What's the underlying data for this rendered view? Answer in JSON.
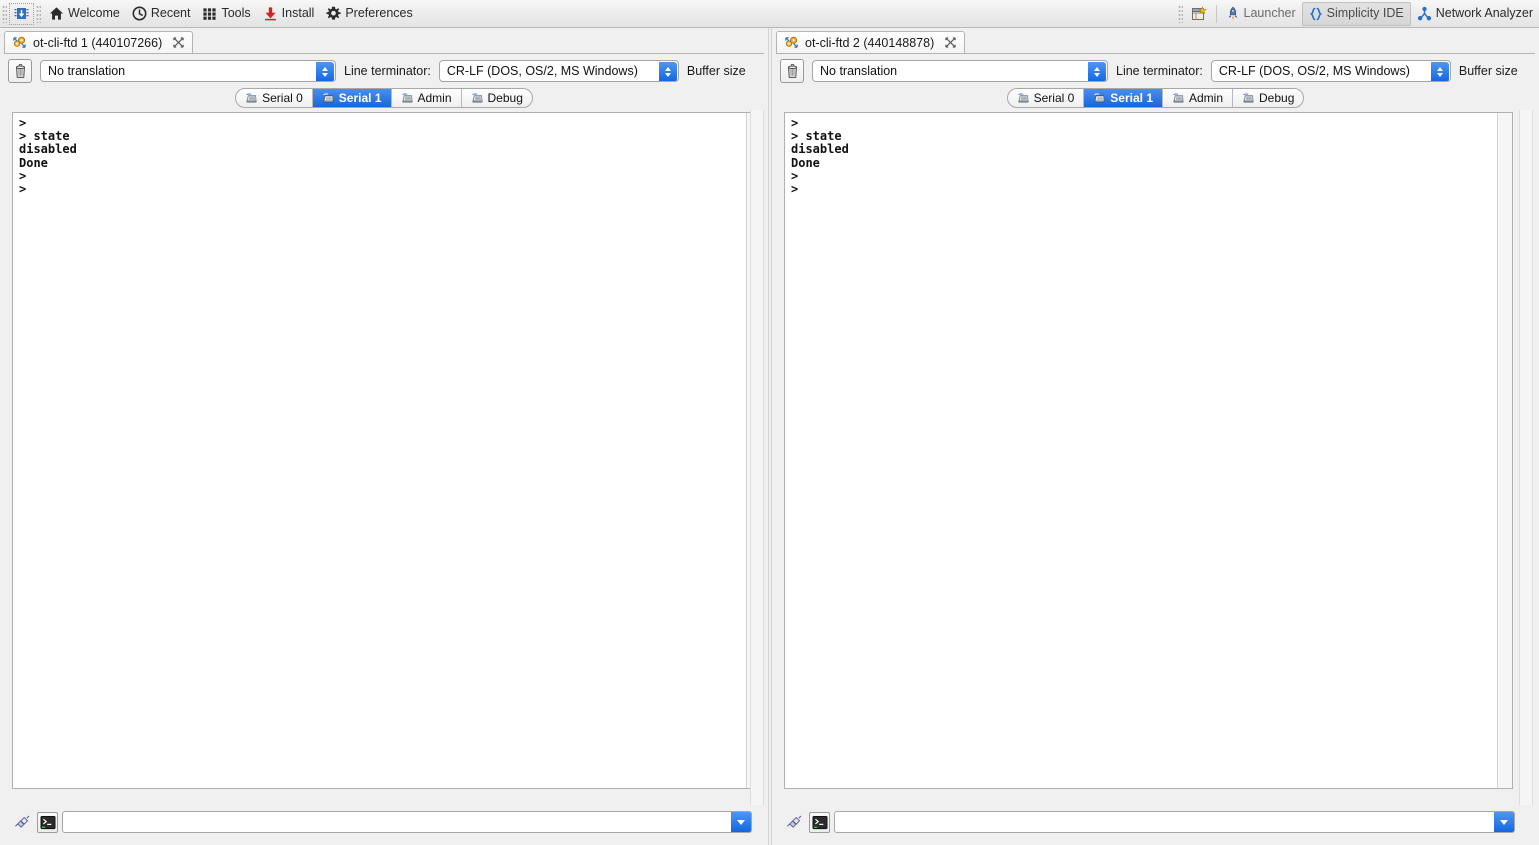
{
  "toolbar": {
    "left_items": [
      {
        "id": "chip",
        "label": "",
        "icon": "chip-icon"
      },
      {
        "id": "welcome",
        "label": "Welcome",
        "icon": "home-icon"
      },
      {
        "id": "recent",
        "label": "Recent",
        "icon": "clock-icon"
      },
      {
        "id": "tools",
        "label": "Tools",
        "icon": "grid-icon"
      },
      {
        "id": "install",
        "label": "Install",
        "icon": "download-icon"
      },
      {
        "id": "preferences",
        "label": "Preferences",
        "icon": "gear-icon"
      }
    ],
    "right_items": [
      {
        "id": "open-perspective",
        "label": "",
        "icon": "open-perspective-icon"
      },
      {
        "id": "launcher",
        "label": "Launcher",
        "icon": "rocket-icon"
      },
      {
        "id": "simplicity-ide",
        "label": "Simplicity IDE",
        "icon": "braces-icon"
      },
      {
        "id": "network-analyzer",
        "label": "Network Analyzer",
        "icon": "network-icon"
      }
    ],
    "active_perspective": "Simplicity IDE",
    "window_controls": {
      "minimize": "minimize-icon",
      "maximize": "maximize-icon"
    }
  },
  "colors": {
    "accent_blue": "#1565d8",
    "tab_gradient_top": "#4d90ee",
    "tab_gradient_bottom": "#1565d8",
    "toolbar_bg": "#ececec",
    "console_bg": "#ffffff",
    "text": "#111111"
  },
  "panels": [
    {
      "id": "panel-1",
      "tab_title": "ot-cli-ftd 1 (440107266)",
      "tab_icon": "serial-gears-icon",
      "close_label": "✖",
      "options": {
        "clear_button_icon": "trash-icon",
        "translation": {
          "value": "No translation",
          "options": [
            "No translation"
          ]
        },
        "line_terminator_label": "Line terminator:",
        "line_terminator": {
          "value": "CR-LF  (DOS, OS/2, MS Windows)",
          "options": [
            "CR-LF  (DOS, OS/2, MS Windows)"
          ]
        },
        "buffer_size_label": "Buffer size"
      },
      "serial_tabs": [
        {
          "label": "Serial 0",
          "icon": "serial-port-icon",
          "active": false
        },
        {
          "label": "Serial 1",
          "icon": "serial-port-icon",
          "active": true
        },
        {
          "label": "Admin",
          "icon": "serial-port-icon",
          "active": false
        },
        {
          "label": "Debug",
          "icon": "serial-port-icon",
          "active": false
        }
      ],
      "console_text": ">\n> state\ndisabled\nDone\n>\n>",
      "input": {
        "value": "",
        "placeholder": "",
        "connect_icon": "plug-icon",
        "console_icon": "terminal-icon",
        "history_icon": "chevron-down-icon"
      }
    },
    {
      "id": "panel-2",
      "tab_title": "ot-cli-ftd 2 (440148878)",
      "tab_icon": "serial-gears-icon",
      "close_label": "✖",
      "options": {
        "clear_button_icon": "trash-icon",
        "translation": {
          "value": "No translation",
          "options": [
            "No translation"
          ]
        },
        "line_terminator_label": "Line terminator:",
        "line_terminator": {
          "value": "CR-LF  (DOS, OS/2, MS Windows)",
          "options": [
            "CR-LF  (DOS, OS/2, MS Windows)"
          ]
        },
        "buffer_size_label": "Buffer size"
      },
      "serial_tabs": [
        {
          "label": "Serial 0",
          "icon": "serial-port-icon",
          "active": false
        },
        {
          "label": "Serial 1",
          "icon": "serial-port-icon",
          "active": true
        },
        {
          "label": "Admin",
          "icon": "serial-port-icon",
          "active": false
        },
        {
          "label": "Debug",
          "icon": "serial-port-icon",
          "active": false
        }
      ],
      "console_text": ">\n> state\ndisabled\nDone\n>\n>",
      "input": {
        "value": "",
        "placeholder": "",
        "connect_icon": "plug-icon",
        "console_icon": "terminal-icon",
        "history_icon": "chevron-down-icon"
      }
    }
  ]
}
